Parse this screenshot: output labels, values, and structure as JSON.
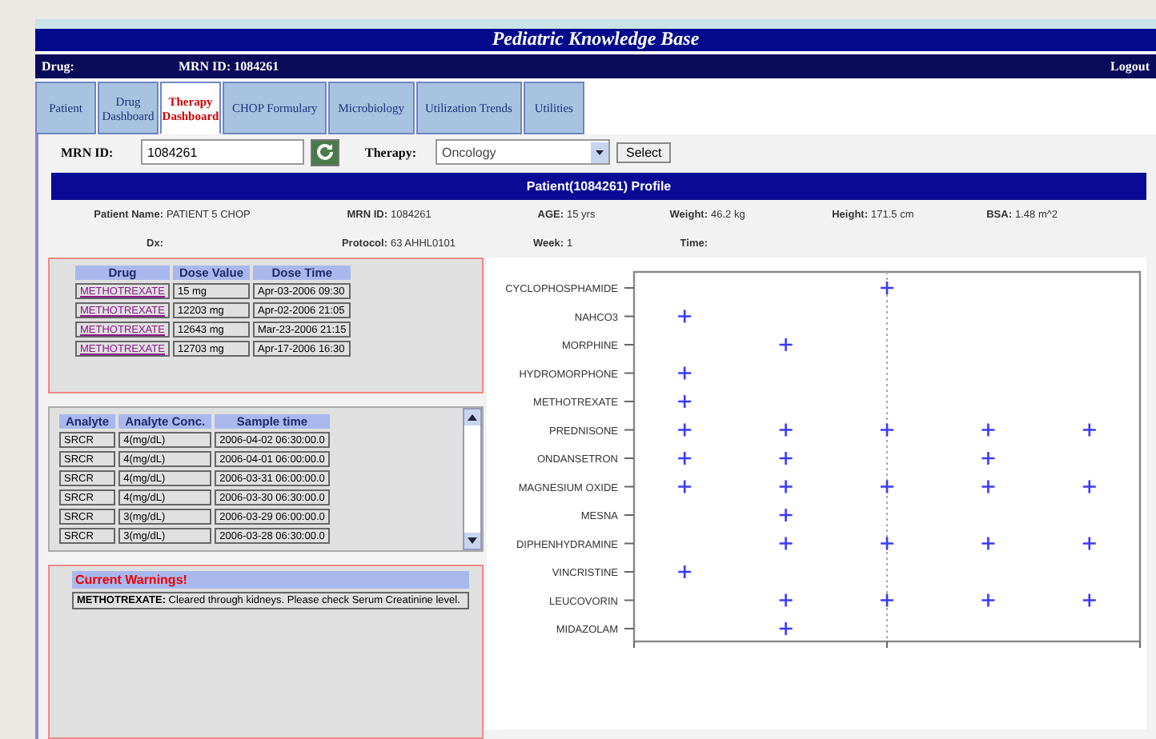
{
  "header": {
    "title": "Pediatric Knowledge Base"
  },
  "user_bar": {
    "drug_label": "Drug:",
    "mrn": "MRN ID:  1084261",
    "logout": "Logout"
  },
  "tabs": [
    {
      "label": "Patient",
      "selected": false
    },
    {
      "label": "Drug Dashboard",
      "selected": false
    },
    {
      "label": "Therapy Dashboard",
      "selected": true
    },
    {
      "label": "CHOP Formulary",
      "selected": false
    },
    {
      "label": "Microbiology",
      "selected": false
    },
    {
      "label": "Utilization Trends",
      "selected": false
    },
    {
      "label": "Utilities",
      "selected": false
    }
  ],
  "form": {
    "mrn_label": "MRN ID:",
    "mrn_value": "1084261",
    "therapy_label": "Therapy:",
    "therapy_value": "Oncology",
    "select_button": "Select"
  },
  "profile": {
    "title": "Patient(1084261) Profile",
    "rows": [
      [
        {
          "label": "Patient Name:",
          "value": "PATIENT 5 CHOP"
        },
        {
          "label": "MRN ID:",
          "value": "1084261"
        },
        {
          "label": "AGE:",
          "value": "15 yrs"
        },
        {
          "label": "Weight:",
          "value": "46.2 kg"
        },
        {
          "label": "Height:",
          "value": "171.5 cm"
        },
        {
          "label": "BSA:",
          "value": "1.48 m^2"
        }
      ],
      [
        {
          "label": "Dx:"
        },
        {
          "label": "Protocol:",
          "value": "63 AHHL0101"
        },
        {
          "label": "Week:",
          "value": "1"
        },
        {
          "label": "Time:"
        }
      ]
    ]
  },
  "doses": {
    "columns": [
      "Drug",
      "Dose Value",
      "Dose Time"
    ],
    "rows": [
      [
        "METHOTREXATE",
        "15 mg",
        "Apr-03-2006 09:30"
      ],
      [
        "METHOTREXATE",
        "12203 mg",
        "Apr-02-2006 21:05"
      ],
      [
        "METHOTREXATE",
        "12643 mg",
        "Mar-23-2006 21:15"
      ],
      [
        "METHOTREXATE",
        "12703 mg",
        "Apr-17-2006 16:30"
      ]
    ]
  },
  "analytes": {
    "columns": [
      "Analyte",
      "Analyte Conc.",
      "Sample time"
    ],
    "rows": [
      [
        "SRCR",
        "4(mg/dL)",
        "2006-04-02 06:30:00.0"
      ],
      [
        "SRCR",
        "4(mg/dL)",
        "2006-04-01 06:00:00.0"
      ],
      [
        "SRCR",
        "4(mg/dL)",
        "2006-03-31 06:00:00.0"
      ],
      [
        "SRCR",
        "4(mg/dL)",
        "2006-03-30 06:30:00.0"
      ],
      [
        "SRCR",
        "3(mg/dL)",
        "2006-03-29 06:00:00.0"
      ],
      [
        "SRCR",
        "3(mg/dL)",
        "2006-03-28 06:30:00.0"
      ]
    ]
  },
  "warnings": {
    "title": "Current Warnings!",
    "text": "**METHOTREXATE:** Cleared through kidneys. Please check Serum Creatinine level."
  },
  "timeline": {
    "rows": [
      {
        "drug": "CYCLOPHOSPHAMIDE",
        "given": [
          false,
          false,
          true,
          false,
          false
        ]
      },
      {
        "drug": "NAHCO3",
        "given": [
          true,
          false,
          false,
          false,
          false
        ]
      },
      {
        "drug": "MORPHINE",
        "given": [
          false,
          true,
          false,
          false,
          false
        ]
      },
      {
        "drug": "HYDROMORPHONE",
        "given": [
          true,
          false,
          false,
          false,
          false
        ]
      },
      {
        "drug": "METHOTREXATE",
        "given": [
          true,
          false,
          false,
          false,
          false
        ]
      },
      {
        "drug": "PREDNISONE",
        "given": [
          true,
          true,
          true,
          true,
          true
        ]
      },
      {
        "drug": "ONDANSETRON",
        "given": [
          true,
          true,
          false,
          true,
          false
        ]
      },
      {
        "drug": "MAGNESIUM OXIDE",
        "given": [
          true,
          true,
          true,
          true,
          true
        ]
      },
      {
        "drug": "MESNA",
        "given": [
          false,
          true,
          false,
          false,
          false
        ]
      },
      {
        "drug": "DIPHENHYDRAMINE",
        "given": [
          false,
          true,
          true,
          true,
          true
        ]
      },
      {
        "drug": "VINCRISTINE",
        "given": [
          true,
          false,
          false,
          false,
          false
        ]
      },
      {
        "drug": "LEUCOVORIN",
        "given": [
          false,
          true,
          true,
          true,
          true
        ]
      },
      {
        "drug": "MIDAZOLAM",
        "given": [
          false,
          true,
          false,
          false,
          false
        ]
      }
    ]
  }
}
